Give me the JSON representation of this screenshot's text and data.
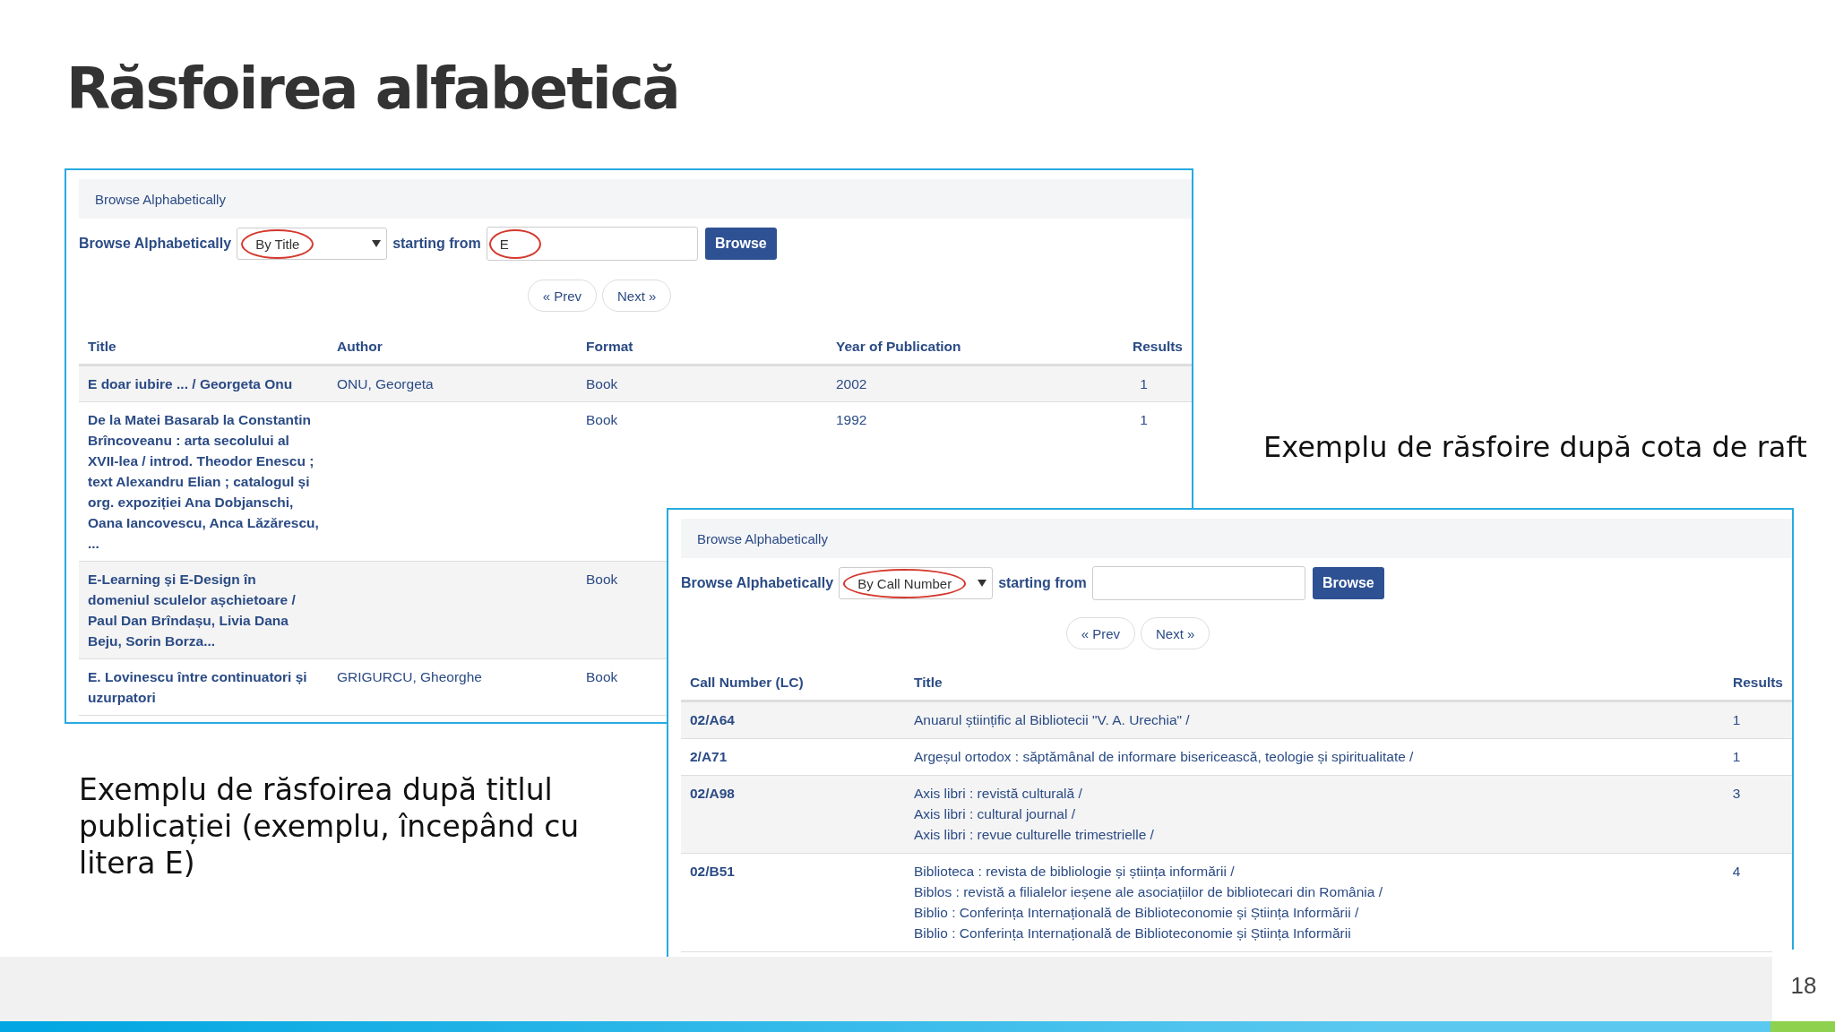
{
  "slide": {
    "title": "Răsfoirea alfabetică",
    "page_number": "18"
  },
  "caption_right": "Exemplu de răsfoire după cota de raft",
  "caption_left": "Exemplu de răsfoirea după titlul publicației (exemplu, începând cu litera E)",
  "title_browse": {
    "header": "Browse Alphabetically",
    "label": "Browse Alphabetically",
    "select": {
      "value": "By Title",
      "circled": true
    },
    "starting_label": "starting from",
    "input": {
      "value": "E",
      "circled": true
    },
    "browse_button": "Browse",
    "prev": "« Prev",
    "next": "Next »",
    "columns": [
      "Title",
      "Author",
      "Format",
      "Year of Publication",
      "Results"
    ],
    "rows": [
      {
        "title": "E doar iubire ... / Georgeta Onu",
        "author": "ONU, Georgeta",
        "format": "Book",
        "year": "2002",
        "results": "1"
      },
      {
        "title": "De la Matei Basarab la Constantin Brîncoveanu : arta secolului al XVII-lea / introd. Theodor Enescu ; text Alexandru Elian ; catalogul și org. expoziției Ana Dobjanschi, Oana Iancovescu, Anca Lăzărescu, ...",
        "format": "Book",
        "year": "1992",
        "results": "1"
      },
      {
        "title": "E-Learning și E-Design în domeniul sculelor așchietoare / Paul Dan Brîndașu, Livia Dana Beju, Sorin Borza...",
        "format": "Book"
      },
      {
        "title": "E. Lovinescu între continuatori și uzurpatori",
        "author": "GRIGURCU, Gheorghe",
        "format": "Book"
      }
    ]
  },
  "call_number_browse": {
    "header": "Browse Alphabetically",
    "label": "Browse Alphabetically",
    "select": {
      "value": "By Call Number",
      "circled": true
    },
    "starting_label": "starting from",
    "input": {
      "circled": false
    },
    "browse_button": "Browse",
    "prev": "« Prev",
    "next": "Next »",
    "columns": [
      "Call Number (LC)",
      "Title",
      "Results"
    ],
    "rows": [
      {
        "call_number": "02/A64",
        "titles": [
          "Anuarul științific al Bibliotecii \"V. A. Urechia\" /"
        ],
        "results": "1"
      },
      {
        "call_number": "2/A71",
        "titles": [
          "Argeșul ortodox : săptămânal de informare bisericească, teologie și spiritualitate /"
        ],
        "results": "1"
      },
      {
        "call_number": "02/A98",
        "titles": [
          "Axis libri : revistă culturală /",
          "Axis libri : cultural journal /",
          "Axis libri : revue culturelle trimestrielle /"
        ],
        "results": "3"
      },
      {
        "call_number": "02/B51",
        "titles": [
          "Biblioteca : revista de bibliologie și știința informării /",
          "Biblos : revistă a filialelor ieșene ale asociațiilor de bibliotecari din România /",
          "Biblio : Conferința Internațională de Biblioteconomie și Știința Informării /",
          "Biblio : Conferința Internațională de Biblioteconomie și Știința Informării"
        ],
        "results": "4"
      }
    ]
  }
}
